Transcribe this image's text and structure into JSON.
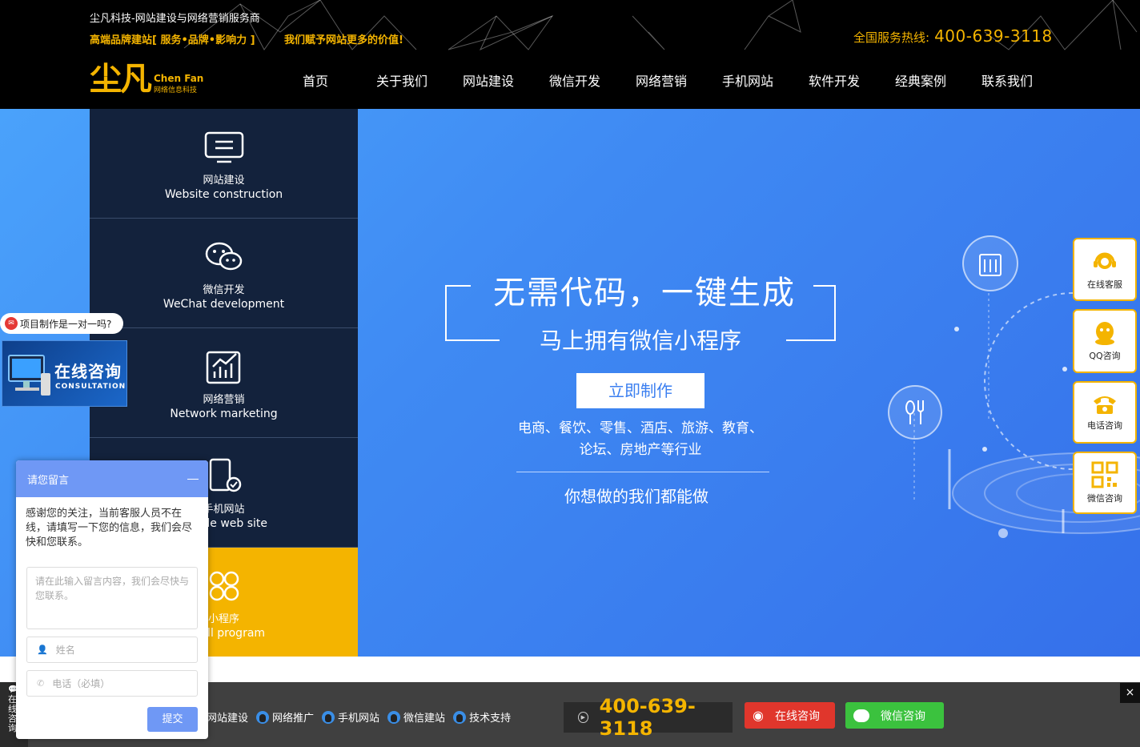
{
  "header": {
    "title": "尘凡科技-网站建设与网络营销服务商",
    "slogan1": "高端品牌建站[ 服务•品牌•影响力 ]",
    "slogan2": "我们赋予网站更多的价值!",
    "hotline_label": "全国服务热线:",
    "hotline_number": "400-639-3118",
    "logo_cn": "尘凡",
    "logo_en": "Chen Fan",
    "logo_sub": "网络信息科技"
  },
  "nav": [
    "首页",
    "关于我们",
    "网站建设",
    "微信开发",
    "网络营销",
    "手机网站",
    "软件开发",
    "经典案例",
    "联系我们"
  ],
  "side_menu": [
    {
      "cn": "网站建设",
      "en": "Website construction",
      "icon": "monitor-icon"
    },
    {
      "cn": "微信开发",
      "en": "WeChat development",
      "icon": "wechat-icon"
    },
    {
      "cn": "网络营销",
      "en": "Network marketing",
      "icon": "chart-icon"
    },
    {
      "cn": "手机网站",
      "en": "Mobile web site",
      "icon": "phone-icon"
    },
    {
      "cn": "小程序",
      "en": "Small program",
      "icon": "mini-program-icon"
    }
  ],
  "hero": {
    "title": "无需代码，一键生成",
    "subtitle": "马上拥有微信小程序",
    "button": "立即制作",
    "industries_line1": "电商、餐饮、零售、酒店、旅游、教育、",
    "industries_line2": "论坛、房地产等行业",
    "tagline": "你想做的我们都能做"
  },
  "right_service": [
    "在线客服",
    "QQ咨询",
    "电话咨询",
    "微信咨询"
  ],
  "left_float": {
    "tip": "项目制作是一对一吗?",
    "consult_cn": "在线咨询",
    "consult_en": "CONSULTATION"
  },
  "message_box": {
    "title": "请您留言",
    "text": "感谢您的关注，当前客服人员不在线，请填写一下您的信息，我们会尽快和您联系。",
    "content_placeholder": "请在此输入留言内容，我们会尽快与您联系。",
    "name_placeholder": "姓名",
    "phone_placeholder": "电话（必填）",
    "submit": "提交"
  },
  "bottom_bar": {
    "side_tab": "在线咨询",
    "links": [
      "网站建设",
      "网络推广",
      "手机网站",
      "微信建站",
      "技术支持"
    ],
    "phone": "400-639-3118",
    "online": "在线咨询",
    "wechat": "微信咨询",
    "close": "×"
  },
  "colors": {
    "accent": "#f4b400",
    "menu_bg": "#13223c",
    "banner_blue": "#3f8af3",
    "message_blue": "#6f98f5"
  }
}
